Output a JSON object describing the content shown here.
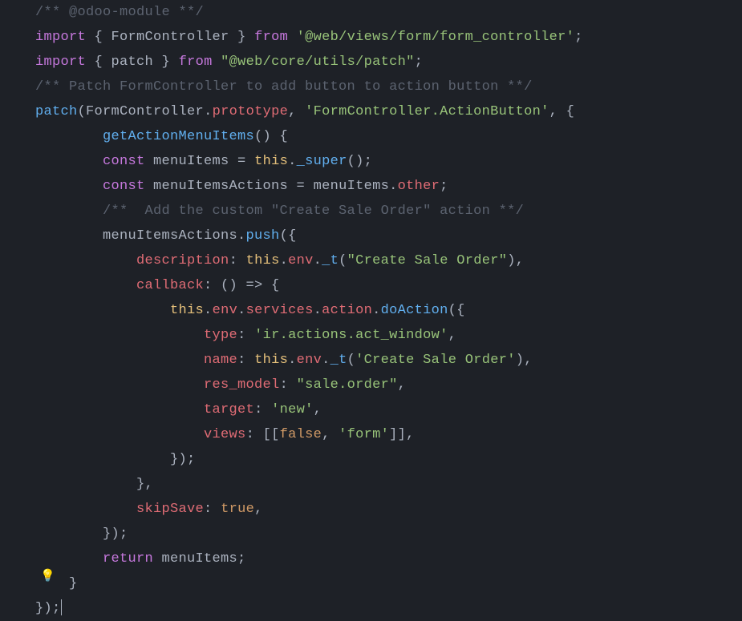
{
  "lines": {
    "l1": "/** @odoo-module **/",
    "l2_import": "import",
    "l2_brace1": " { ",
    "l2_name": "FormController",
    "l2_brace2": " } ",
    "l2_from": "from",
    "l2_str": "'@web/views/form/form_controller'",
    "l2_semi": ";",
    "l3_import": "import",
    "l3_brace1": " { ",
    "l3_name": "patch",
    "l3_brace2": " } ",
    "l3_from": "from",
    "l3_str": "\"@web/core/utils/patch\"",
    "l3_semi": ";",
    "l4": "/** Patch FormController to add button to action button **/",
    "l5_1": "patch",
    "l5_2": "(",
    "l5_3": "FormController",
    "l5_4": ".",
    "l5_5": "prototype",
    "l5_6": ", ",
    "l5_7": "'FormController.ActionButton'",
    "l5_8": ", {",
    "l6_1": "        ",
    "l6_2": "getActionMenuItems",
    "l6_3": "() {",
    "l7_1": "        ",
    "l7_2": "const",
    "l7_3": " menuItems = ",
    "l7_4": "this",
    "l7_5": ".",
    "l7_6": "_super",
    "l7_7": "();",
    "l8_1": "        ",
    "l8_2": "const",
    "l8_3": " menuItemsActions = menuItems.",
    "l8_4": "other",
    "l8_5": ";",
    "l9": "        /**  Add the custom \"Create Sale Order\" action **/",
    "l10_1": "        menuItemsActions.",
    "l10_2": "push",
    "l10_3": "({",
    "l11_1": "            ",
    "l11_2": "description",
    "l11_3": ": ",
    "l11_4": "this",
    "l11_5": ".",
    "l11_6": "env",
    "l11_7": ".",
    "l11_8": "_t",
    "l11_9": "(",
    "l11_10": "\"Create Sale Order\"",
    "l11_11": "),",
    "l12_1": "            ",
    "l12_2": "callback",
    "l12_3": ": () => {",
    "l13_1": "                ",
    "l13_2": "this",
    "l13_3": ".",
    "l13_4": "env",
    "l13_5": ".",
    "l13_6": "services",
    "l13_7": ".",
    "l13_8": "action",
    "l13_9": ".",
    "l13_10": "doAction",
    "l13_11": "({",
    "l14_1": "                    ",
    "l14_2": "type",
    "l14_3": ": ",
    "l14_4": "'ir.actions.act_window'",
    "l14_5": ",",
    "l15_1": "                    ",
    "l15_2": "name",
    "l15_3": ": ",
    "l15_4": "this",
    "l15_5": ".",
    "l15_6": "env",
    "l15_7": ".",
    "l15_8": "_t",
    "l15_9": "(",
    "l15_10": "'Create Sale Order'",
    "l15_11": "),",
    "l16_1": "                    ",
    "l16_2": "res_model",
    "l16_3": ": ",
    "l16_4": "\"sale.order\"",
    "l16_5": ",",
    "l17_1": "                    ",
    "l17_2": "target",
    "l17_3": ": ",
    "l17_4": "'new'",
    "l17_5": ",",
    "l18_1": "                    ",
    "l18_2": "views",
    "l18_3": ": [[",
    "l18_4": "false",
    "l18_5": ", ",
    "l18_6": "'form'",
    "l18_7": "]],",
    "l19": "                });",
    "l20": "            },",
    "l21_1": "            ",
    "l21_2": "skipSave",
    "l21_3": ": ",
    "l21_4": "true",
    "l21_5": ",",
    "l22": "        });",
    "l23_1": "        ",
    "l23_2": "return",
    "l23_3": " menuItems;",
    "l24": "    }",
    "l25": "});"
  },
  "bulb": "💡"
}
